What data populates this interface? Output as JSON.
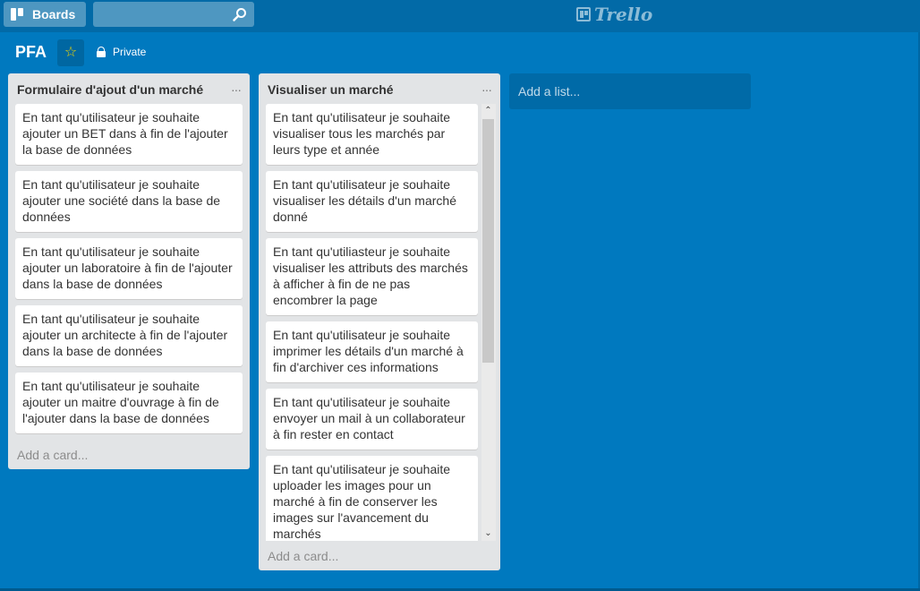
{
  "header": {
    "boards_label": "Boards",
    "search_placeholder": "",
    "logo_text": "Trello"
  },
  "board": {
    "title": "PFA",
    "visibility": "Private",
    "star_color": "#f2d600"
  },
  "lists": [
    {
      "title": "Formulaire d'ajout d'un marché",
      "menu": "···",
      "add_card": "Add a card...",
      "cards": [
        "En tant qu'utilisateur je souhaite ajouter un BET dans à fin de l'ajouter la base de données",
        "En tant qu'utilisateur je souhaite ajouter une société dans la base de données",
        "En tant qu'utilisateur je souhaite ajouter un laboratoire à fin de l'ajouter dans la base de données",
        "En tant qu'utilisateur je souhaite ajouter un architecte à fin de l'ajouter dans la base de données",
        "En tant qu'utilisateur je souhaite ajouter un maitre d'ouvrage à fin de l'ajouter dans la base de données"
      ]
    },
    {
      "title": "Visualiser un marché",
      "menu": "···",
      "add_card": "Add a card...",
      "cards": [
        "En tant qu'utilisateur je souhaite visualiser tous les marchés par leurs type et année",
        "En tant qu'utilisateur je souhaite visualiser les détails d'un marché donné",
        "En tant qu'utiliasteur je souhaite visualiser les attributs des marchés à afficher à fin de ne pas encombrer la page",
        "En tant qu'utilisateur je souhaite imprimer les détails d'un marché à fin d'archiver ces informations",
        "En tant qu'utilisateur je souhaite envoyer un mail à un collaborateur à fin rester en contact",
        "En tant qu'utilisateur je souhaite uploader les images pour un marché à fin de conserver les images sur l'avancement du marchés"
      ]
    }
  ],
  "add_list_label": "Add a list...",
  "colors": {
    "board_bg": "#0079bf",
    "header_bg": "#026aa7",
    "list_bg": "#e2e4e6"
  }
}
